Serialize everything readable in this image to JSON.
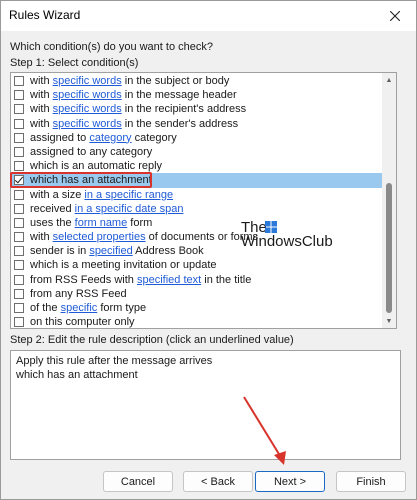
{
  "window": {
    "title": "Rules Wizard"
  },
  "question": "Which condition(s) do you want to check?",
  "step1_label": "Step 1: Select condition(s)",
  "conditions": [
    {
      "parts": [
        {
          "t": "with "
        },
        {
          "t": "specific words",
          "link": true
        },
        {
          "t": " in the subject or body"
        }
      ],
      "checked": false,
      "selected": false
    },
    {
      "parts": [
        {
          "t": "with "
        },
        {
          "t": "specific words",
          "link": true
        },
        {
          "t": " in the message header"
        }
      ],
      "checked": false,
      "selected": false
    },
    {
      "parts": [
        {
          "t": "with "
        },
        {
          "t": "specific words",
          "link": true
        },
        {
          "t": " in the recipient's address"
        }
      ],
      "checked": false,
      "selected": false
    },
    {
      "parts": [
        {
          "t": "with "
        },
        {
          "t": "specific words",
          "link": true
        },
        {
          "t": " in the sender's address"
        }
      ],
      "checked": false,
      "selected": false
    },
    {
      "parts": [
        {
          "t": "assigned to "
        },
        {
          "t": "category",
          "link": true
        },
        {
          "t": " category"
        }
      ],
      "checked": false,
      "selected": false
    },
    {
      "parts": [
        {
          "t": "assigned to any category"
        }
      ],
      "checked": false,
      "selected": false
    },
    {
      "parts": [
        {
          "t": "which is an automatic reply"
        }
      ],
      "checked": false,
      "selected": false
    },
    {
      "parts": [
        {
          "t": "which has an attachment"
        }
      ],
      "checked": true,
      "selected": true
    },
    {
      "parts": [
        {
          "t": "with a size "
        },
        {
          "t": "in a specific range",
          "link": true
        }
      ],
      "checked": false,
      "selected": false
    },
    {
      "parts": [
        {
          "t": "received "
        },
        {
          "t": "in a specific date span",
          "link": true
        }
      ],
      "checked": false,
      "selected": false
    },
    {
      "parts": [
        {
          "t": "uses the "
        },
        {
          "t": "form name",
          "link": true
        },
        {
          "t": " form"
        }
      ],
      "checked": false,
      "selected": false
    },
    {
      "parts": [
        {
          "t": "with "
        },
        {
          "t": "selected properties",
          "link": true
        },
        {
          "t": " of documents or forms"
        }
      ],
      "checked": false,
      "selected": false
    },
    {
      "parts": [
        {
          "t": "sender is in "
        },
        {
          "t": "specified",
          "link": true
        },
        {
          "t": " Address Book"
        }
      ],
      "checked": false,
      "selected": false
    },
    {
      "parts": [
        {
          "t": "which is a meeting invitation or update"
        }
      ],
      "checked": false,
      "selected": false
    },
    {
      "parts": [
        {
          "t": "from RSS Feeds with "
        },
        {
          "t": "specified text",
          "link": true
        },
        {
          "t": " in the title"
        }
      ],
      "checked": false,
      "selected": false
    },
    {
      "parts": [
        {
          "t": "from any RSS Feed"
        }
      ],
      "checked": false,
      "selected": false
    },
    {
      "parts": [
        {
          "t": "of the "
        },
        {
          "t": "specific",
          "link": true
        },
        {
          "t": " form type"
        }
      ],
      "checked": false,
      "selected": false
    },
    {
      "parts": [
        {
          "t": "on this computer only"
        }
      ],
      "checked": false,
      "selected": false
    }
  ],
  "watermark": {
    "line1": "The",
    "line2": "WindowsClub"
  },
  "step2_label": "Step 2: Edit the rule description (click an underlined value)",
  "description": {
    "line1": "Apply this rule after the message arrives",
    "line2": "which has an attachment"
  },
  "buttons": {
    "cancel": "Cancel",
    "back": "< Back",
    "next": "Next >",
    "finish": "Finish"
  },
  "colors": {
    "selection": "#99c9ef",
    "link": "#1f5bd6",
    "annotation": "#d9342b"
  }
}
